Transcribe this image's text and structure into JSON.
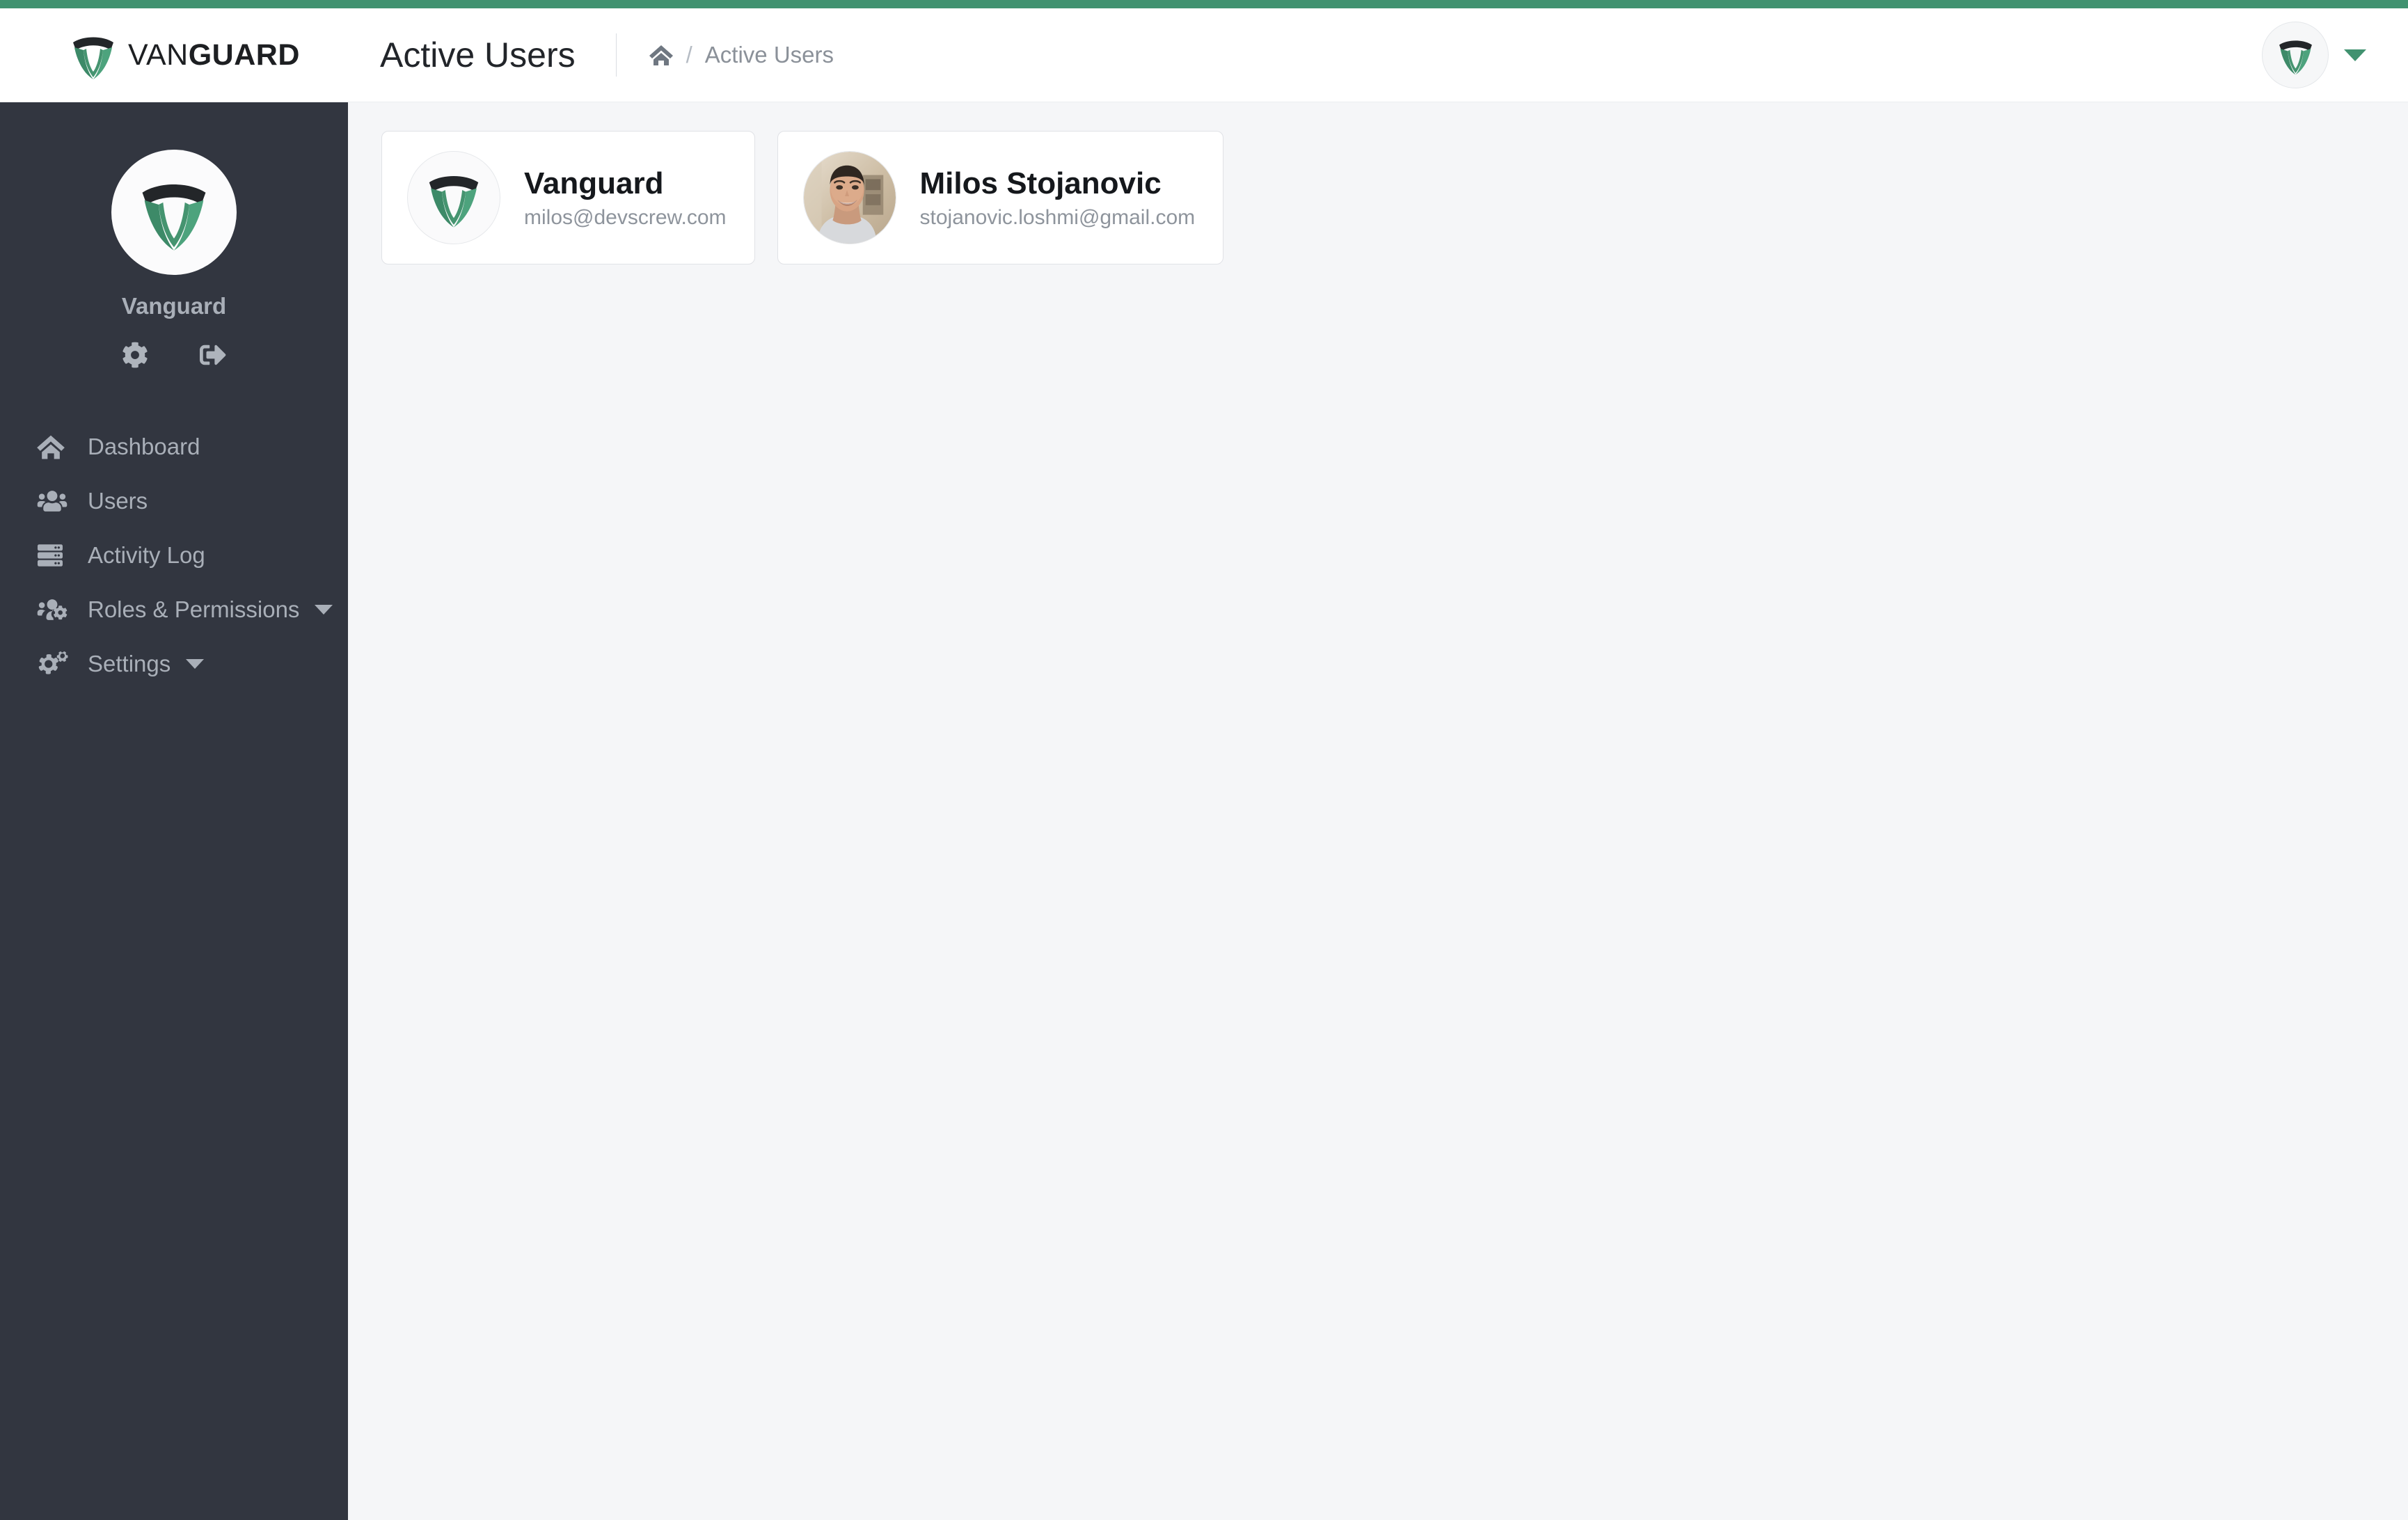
{
  "theme": {
    "accent_green": "#419270",
    "sidebar_bg": "#323640",
    "content_bg": "#f5f6f8",
    "muted_text": "#8e949c"
  },
  "brand": {
    "name_light": "VAN",
    "name_bold": "GUARD",
    "logo_icon": "vanguard-shield-icon"
  },
  "header": {
    "page_title": "Active Users",
    "breadcrumb": {
      "home_icon": "home-icon",
      "separator": "/",
      "current": "Active Users"
    },
    "account": {
      "avatar_icon": "vanguard-shield-icon",
      "dropdown_icon": "chevron-down-icon"
    }
  },
  "sidebar": {
    "profile": {
      "avatar_icon": "vanguard-shield-icon",
      "name": "Vanguard",
      "settings_icon": "gear-icon",
      "logout_icon": "sign-out-icon"
    },
    "items": [
      {
        "label": "Dashboard",
        "icon": "home-icon",
        "has_caret": false
      },
      {
        "label": "Users",
        "icon": "users-icon",
        "has_caret": false
      },
      {
        "label": "Activity Log",
        "icon": "server-list-icon",
        "has_caret": false
      },
      {
        "label": "Roles & Permissions",
        "icon": "users-cog-icon",
        "has_caret": true
      },
      {
        "label": "Settings",
        "icon": "cogs-icon",
        "has_caret": true
      }
    ]
  },
  "main": {
    "users": [
      {
        "name": "Vanguard",
        "email": "milos@devscrew.com",
        "avatar_type": "logo",
        "avatar_icon": "vanguard-shield-icon"
      },
      {
        "name": "Milos Stojanovic",
        "email": "stojanovic.loshmi@gmail.com",
        "avatar_type": "photo",
        "avatar_icon": "user-photo"
      }
    ]
  }
}
